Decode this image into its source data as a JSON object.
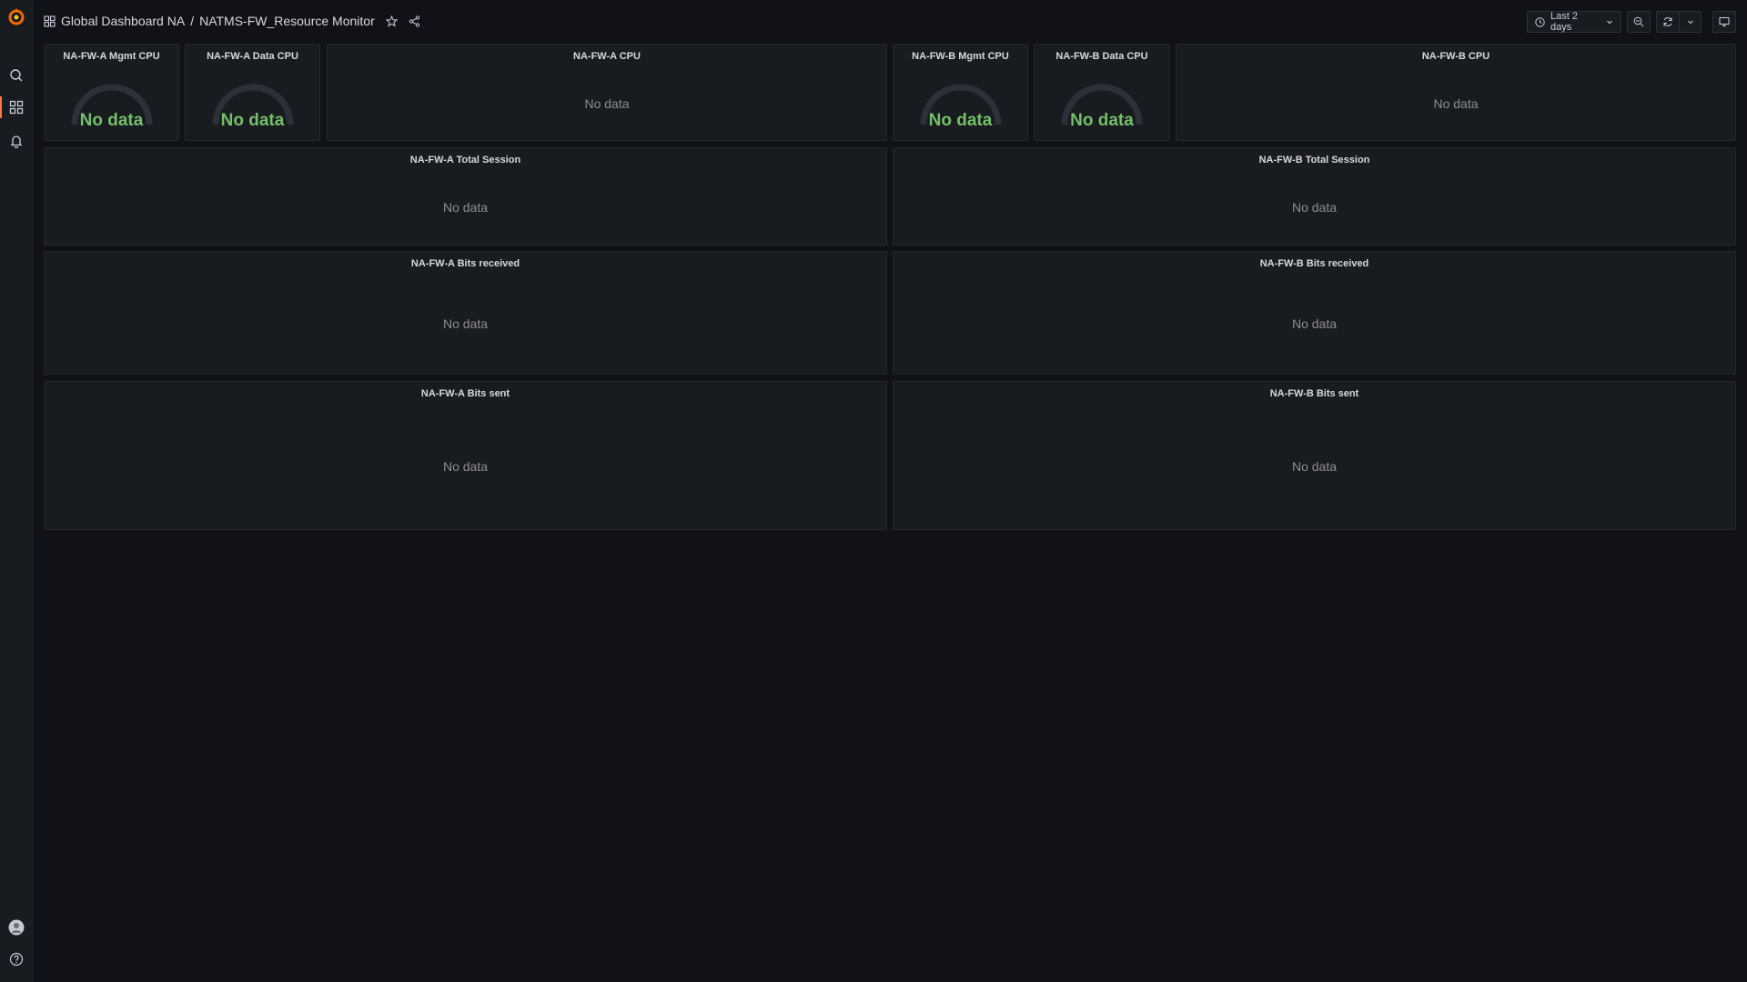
{
  "breadcrumb": {
    "folder": "Global Dashboard NA",
    "separator": "/",
    "dashboard": "NATMS-FW_Resource Monitor"
  },
  "toolbar": {
    "time_range": "Last 2 days"
  },
  "colors": {
    "background": "#111217",
    "panel": "#181b1f",
    "gauge_value": "#73bf69",
    "accent": "#ff7941"
  },
  "panels": {
    "fw_a_mgmt_cpu": {
      "title": "NA-FW-A Mgmt CPU",
      "value": "No data"
    },
    "fw_a_data_cpu": {
      "title": "NA-FW-A Data CPU",
      "value": "No data"
    },
    "fw_a_cpu": {
      "title": "NA-FW-A CPU",
      "value": "No data"
    },
    "fw_b_mgmt_cpu": {
      "title": "NA-FW-B Mgmt CPU",
      "value": "No data"
    },
    "fw_b_data_cpu": {
      "title": "NA-FW-B Data CPU",
      "value": "No data"
    },
    "fw_b_cpu": {
      "title": "NA-FW-B CPU",
      "value": "No data"
    },
    "fw_a_total_session": {
      "title": "NA-FW-A Total Session",
      "value": "No data"
    },
    "fw_b_total_session": {
      "title": "NA-FW-B Total Session",
      "value": "No data"
    },
    "fw_a_bits_received": {
      "title": "NA-FW-A Bits received",
      "value": "No data"
    },
    "fw_b_bits_received": {
      "title": "NA-FW-B Bits received",
      "value": "No data"
    },
    "fw_a_bits_sent": {
      "title": "NA-FW-A Bits sent",
      "value": "No data"
    },
    "fw_b_bits_sent": {
      "title": "NA-FW-B Bits sent",
      "value": "No data"
    }
  },
  "icons": {
    "logo": "grafana-logo",
    "search": "search-icon",
    "dashboards": "dashboards-icon",
    "alerting": "bell-icon",
    "profile": "avatar",
    "help": "help-icon"
  }
}
